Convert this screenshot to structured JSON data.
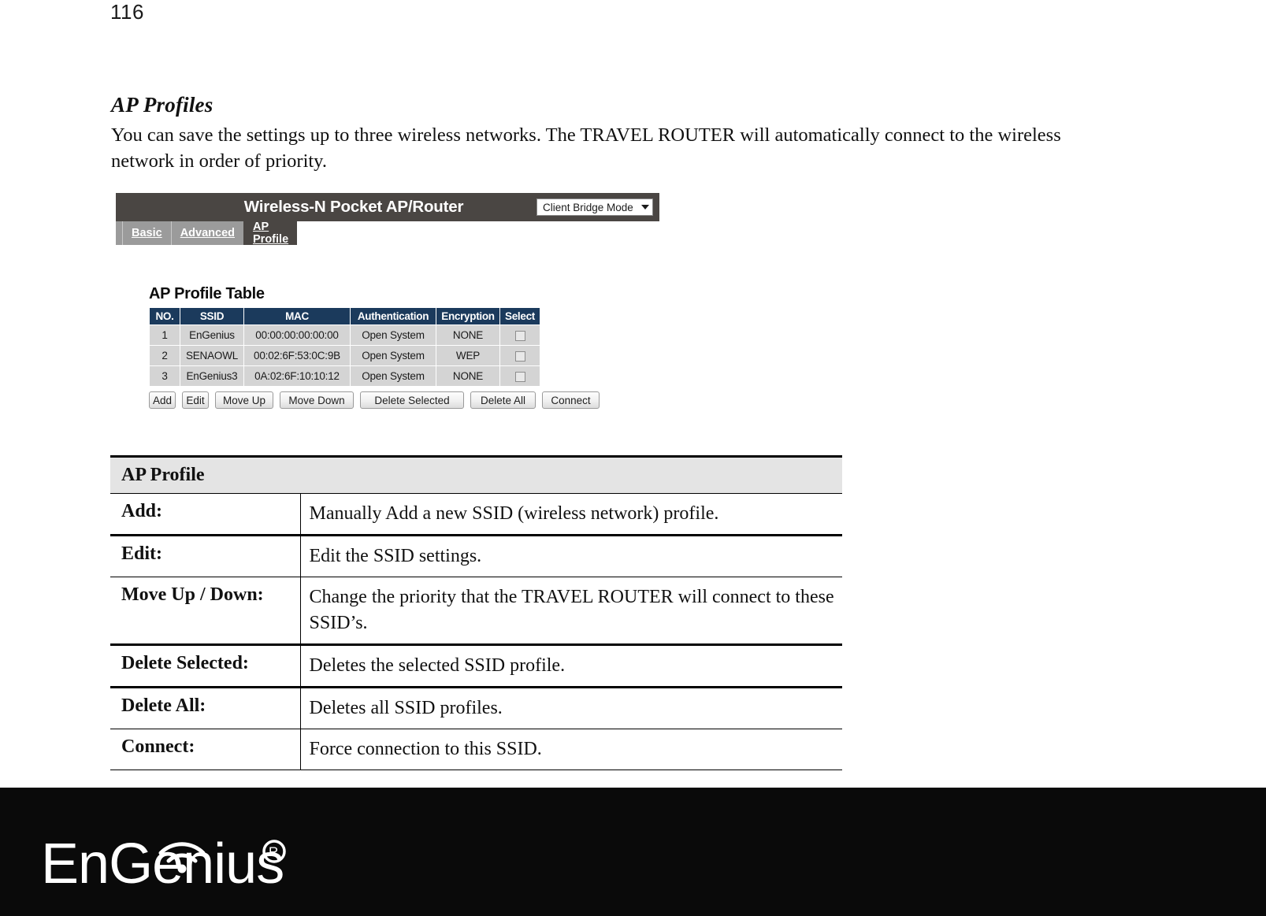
{
  "page": {
    "number": "116"
  },
  "article": {
    "heading": "AP Profiles",
    "paragraph": "You can save the settings up to three wireless networks. The TRAVEL ROUTER will automatically connect to the wireless network in order of priority."
  },
  "router_ui": {
    "title": "Wireless-N Pocket AP/Router",
    "mode_select": {
      "selected": "Client Bridge Mode",
      "icon": "chevron-down-icon"
    },
    "tabs": [
      {
        "label": "Basic",
        "active": false
      },
      {
        "label": "Advanced",
        "active": false
      },
      {
        "label": "AP Profile",
        "active": true
      }
    ],
    "profile_table": {
      "title": "AP Profile Table",
      "columns": [
        "NO.",
        "SSID",
        "MAC",
        "Authentication",
        "Encryption",
        "Select"
      ],
      "rows": [
        {
          "no": "1",
          "ssid": "EnGenius",
          "mac": "00:00:00:00:00:00",
          "authentication": "Open System",
          "encryption": "NONE",
          "selected": false
        },
        {
          "no": "2",
          "ssid": "SENAOWL",
          "mac": "00:02:6F:53:0C:9B",
          "authentication": "Open System",
          "encryption": "WEP",
          "selected": false
        },
        {
          "no": "3",
          "ssid": "EnGenius3",
          "mac": "0A:02:6F:10:10:12",
          "authentication": "Open System",
          "encryption": "NONE",
          "selected": false
        }
      ]
    },
    "buttons": [
      {
        "label": "Add"
      },
      {
        "label": "Edit"
      },
      {
        "label": "Move Up"
      },
      {
        "label": "Move Down"
      },
      {
        "label": "Delete Selected"
      },
      {
        "label": "Delete All"
      },
      {
        "label": "Connect"
      }
    ]
  },
  "description_table": {
    "header": "AP Profile",
    "rows": [
      {
        "label": "Add:",
        "value": "Manually Add a new SSID (wireless network) profile."
      },
      {
        "label": "Edit:",
        "value": "Edit the SSID settings."
      },
      {
        "label": "Move Up / Down:",
        "value": "Change the priority that the TRAVEL ROUTER will connect to these SSID’s."
      },
      {
        "label": "Delete Selected:",
        "value": "Deletes the selected SSID profile."
      },
      {
        "label": "Delete All:",
        "value": "Deletes all SSID profiles."
      },
      {
        "label": "Connect:",
        "value": "Force connection to this SSID."
      }
    ]
  },
  "footer": {
    "brand": "EnGenius",
    "registered_mark": "®",
    "logo_icon": "engenius-wifi-logo",
    "background_color": "#0a0a0a"
  },
  "colors": {
    "router_titlebar": "#4a4643",
    "tabbar": "#9b9b9b",
    "table_header": "#1b3a5c",
    "table_row": "#d4d4d4",
    "desc_header": "#e4e4e4"
  }
}
